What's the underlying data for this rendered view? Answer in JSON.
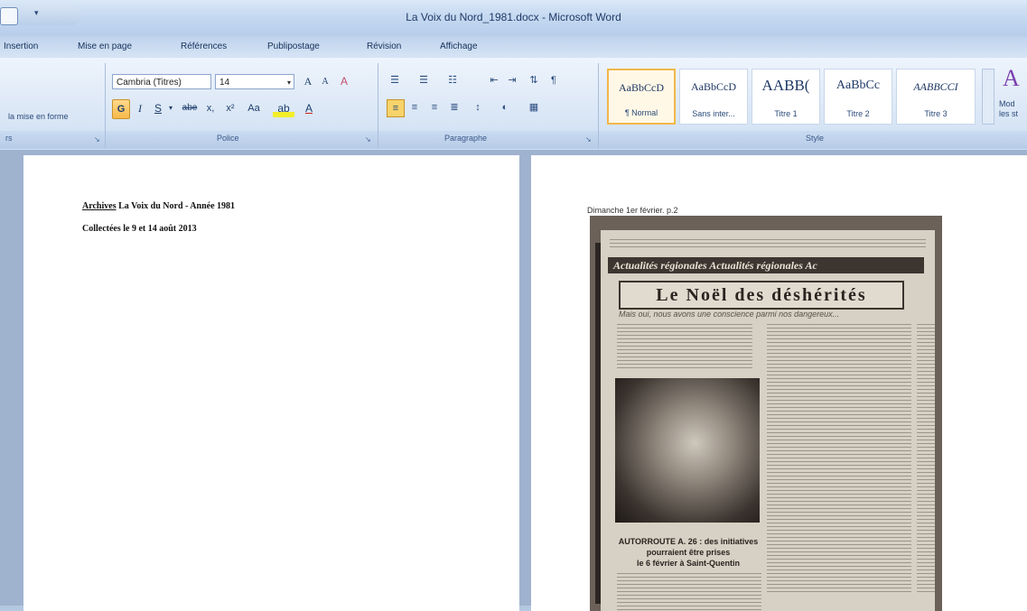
{
  "window": {
    "title": "La Voix du Nord_1981.docx - Microsoft Word"
  },
  "tabs": [
    {
      "label": "Insertion"
    },
    {
      "label": "Mise en page"
    },
    {
      "label": "Références"
    },
    {
      "label": "Publipostage"
    },
    {
      "label": "Révision"
    },
    {
      "label": "Affichage"
    }
  ],
  "ribbon": {
    "clipboard": {
      "format_painter_label": "la mise en forme",
      "group_label": "rs"
    },
    "font": {
      "font_name": "Cambria (Titres)",
      "font_size": "14",
      "bold_glyph": "G",
      "italic_glyph": "I",
      "underline_glyph": "S",
      "strike_glyph": "abe",
      "subscript_glyph": "x,",
      "superscript_glyph": "x²",
      "case_glyph": "Aa",
      "grow_glyph": "A",
      "shrink_glyph": "A",
      "clear_glyph": "A",
      "fontcolor_glyph": "A",
      "group_label": "Police"
    },
    "paragraph": {
      "group_label": "Paragraphe"
    },
    "styles": {
      "items": [
        {
          "sample": "AaBbCcD",
          "name": "¶ Normal",
          "size": "12px"
        },
        {
          "sample": "AaBbCcD",
          "name": "Sans inter...",
          "size": "12px"
        },
        {
          "sample": "AABB(",
          "name": "Titre 1",
          "size": "17px"
        },
        {
          "sample": "AaBbCc",
          "name": "Titre 2",
          "size": "14px"
        },
        {
          "sample": "AABBCCI",
          "name": "Titre 3",
          "size": "12px"
        }
      ],
      "change_styles_label": "Mod les st",
      "group_label": "Style"
    }
  },
  "document": {
    "page1": {
      "line1_underlined": "Archives",
      "line1_rest": " La Voix du Nord - Année 1981",
      "line2": "Collectées le 9 et 14 août 2013"
    },
    "page2": {
      "caption": "Dimanche 1er février. p.2",
      "newspaper": {
        "banner": "Actualités régionales Actualités régionales Ac",
        "headline": "Le Noël des déshérités",
        "subhead": "Mais oui, nous avons une conscience parmi nos dangereux...",
        "photo_caption_1": "AUTORROUTE A. 26 : des initiatives",
        "photo_caption_2": "pourraient être prises",
        "photo_caption_3": "le 6 février à Saint-Quentin"
      }
    }
  }
}
